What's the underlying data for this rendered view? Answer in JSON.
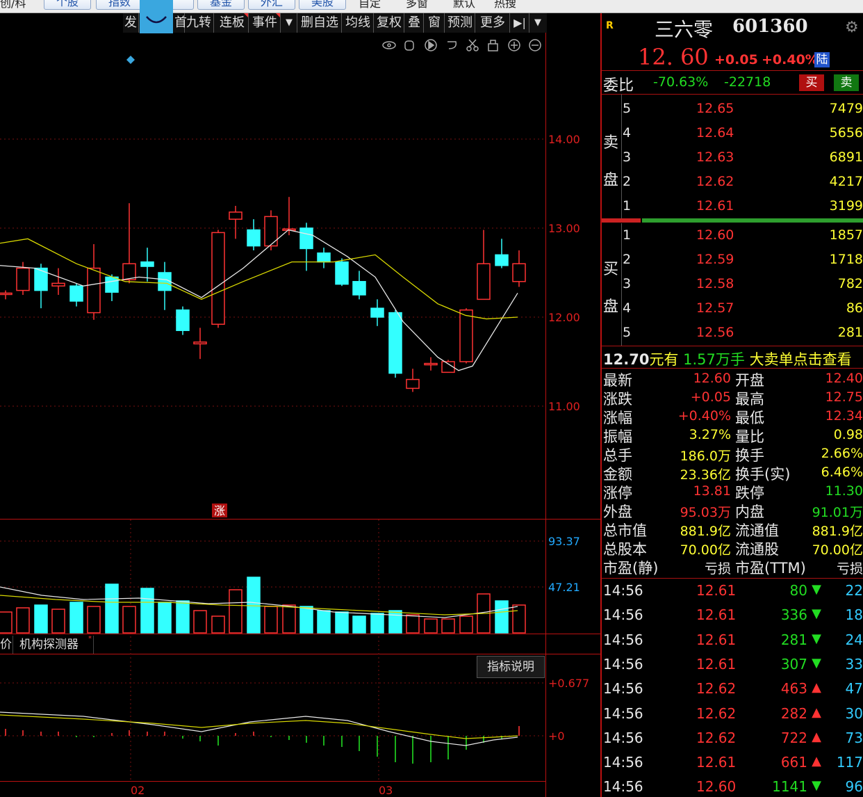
{
  "topbar": {
    "items": [
      "创/科",
      "个股",
      "指数",
      "",
      "基金",
      "外汇",
      "美股",
      "自定",
      "多窗",
      "默认",
      "热搜"
    ]
  },
  "toolbar": {
    "buttons": [
      "发",
      "首",
      "九转",
      "连板",
      "事件",
      "▼",
      "删自选",
      "均线",
      "复权",
      "叠",
      "窗",
      "预测",
      "更多",
      "▶|",
      "▼"
    ]
  },
  "price_axis": [
    "14.00",
    "13.00",
    "12.00",
    "11.00"
  ],
  "volume_axis": [
    "93.37",
    "47.21"
  ],
  "macd_axis": [
    "+0.677",
    "+0"
  ],
  "date_axis": [
    "02",
    "03"
  ],
  "zhang_marker": "涨",
  "indicator_tabs": [
    "价",
    "机构探测器"
  ],
  "indicator_help": "指标说明",
  "colors": {
    "up": "#ff3333",
    "down": "#33ffff",
    "ma1": "#e8e8e8",
    "ma2": "#e0e000",
    "bg": "#000000"
  },
  "stock": {
    "badge": "R",
    "name": "三六零",
    "code": "601360",
    "price": "12. 60",
    "change": "+0.05",
    "change_pct": "+0.40%",
    "market_tag": "陆",
    "weibi_label": "委比",
    "weibi_pct": "-70.63%",
    "weibi_diff": "-22718",
    "buy_btn": "买",
    "sell_btn": "卖"
  },
  "orderbook": {
    "sell_label": [
      "卖",
      "盘"
    ],
    "buy_label": [
      "买",
      "盘"
    ],
    "sell": [
      {
        "lvl": "5",
        "price": "12.65",
        "vol": "7479"
      },
      {
        "lvl": "4",
        "price": "12.64",
        "vol": "5656"
      },
      {
        "lvl": "3",
        "price": "12.63",
        "vol": "6891"
      },
      {
        "lvl": "2",
        "price": "12.62",
        "vol": "4217"
      },
      {
        "lvl": "1",
        "price": "12.61",
        "vol": "3199"
      }
    ],
    "buy": [
      {
        "lvl": "1",
        "price": "12.60",
        "vol": "1857"
      },
      {
        "lvl": "2",
        "price": "12.59",
        "vol": "1718"
      },
      {
        "lvl": "3",
        "price": "12.58",
        "vol": "782"
      },
      {
        "lvl": "4",
        "price": "12.57",
        "vol": "86"
      },
      {
        "lvl": "5",
        "price": "12.56",
        "vol": "281"
      }
    ]
  },
  "big_order": {
    "price": "12.70",
    "t1": "元有",
    "qty": "1.57万手",
    "t2": "大卖单点击查看"
  },
  "stats": [
    {
      "l1": "最新",
      "v1": "12.60",
      "c1": "red",
      "l2": "开盘",
      "v2": "12.40",
      "c2": "red"
    },
    {
      "l1": "涨跌",
      "v1": "+0.05",
      "c1": "red",
      "l2": "最高",
      "v2": "12.75",
      "c2": "red"
    },
    {
      "l1": "涨幅",
      "v1": "+0.40%",
      "c1": "red",
      "l2": "最低",
      "v2": "12.34",
      "c2": "red"
    },
    {
      "l1": "振幅",
      "v1": "3.27%",
      "c1": "yel",
      "l2": "量比",
      "v2": "0.98",
      "c2": "yel"
    },
    {
      "l1": "总手",
      "v1": "186.0万",
      "c1": "yel",
      "l2": "换手",
      "v2": "2.66%",
      "c2": "yel"
    },
    {
      "l1": "金额",
      "v1": "23.36亿",
      "c1": "yel",
      "l2": "换手(实)",
      "v2": "6.46%",
      "c2": "yel"
    },
    {
      "l1": "涨停",
      "v1": "13.81",
      "c1": "red",
      "l2": "跌停",
      "v2": "11.30",
      "c2": "grn"
    },
    {
      "l1": "外盘",
      "v1": "95.03万",
      "c1": "red",
      "l2": "内盘",
      "v2": "91.01万",
      "c2": "grn"
    },
    {
      "l1": "总市值",
      "v1": "881.9亿",
      "c1": "yel",
      "l2": "流通值",
      "v2": "881.9亿",
      "c2": "yel"
    },
    {
      "l1": "总股本",
      "v1": "70.00亿",
      "c1": "yel",
      "l2": "流通股",
      "v2": "70.00亿",
      "c2": "yel"
    },
    {
      "l1": "市盈(静)",
      "v1": "亏损",
      "c1": "wht",
      "l2": "市盈(TTM)",
      "v2": "亏损",
      "c2": "wht"
    }
  ],
  "ticks": [
    {
      "time": "14:56",
      "price": "12.61",
      "pc": "red",
      "vol": "80",
      "dir": "down",
      "n": "22"
    },
    {
      "time": "14:56",
      "price": "12.61",
      "pc": "red",
      "vol": "336",
      "dir": "down",
      "n": "18"
    },
    {
      "time": "14:56",
      "price": "12.61",
      "pc": "red",
      "vol": "281",
      "dir": "down",
      "n": "24"
    },
    {
      "time": "14:56",
      "price": "12.61",
      "pc": "red",
      "vol": "307",
      "dir": "down",
      "n": "33"
    },
    {
      "time": "14:56",
      "price": "12.62",
      "pc": "red",
      "vol": "463",
      "dir": "up",
      "n": "47"
    },
    {
      "time": "14:56",
      "price": "12.62",
      "pc": "red",
      "vol": "282",
      "dir": "up",
      "n": "30"
    },
    {
      "time": "14:56",
      "price": "12.62",
      "pc": "red",
      "vol": "722",
      "dir": "up",
      "n": "73"
    },
    {
      "time": "14:56",
      "price": "12.61",
      "pc": "red",
      "vol": "661",
      "dir": "up",
      "n": "117"
    },
    {
      "time": "14:56",
      "price": "12.60",
      "pc": "red",
      "vol": "1141",
      "dir": "down",
      "n": "96"
    }
  ]
}
